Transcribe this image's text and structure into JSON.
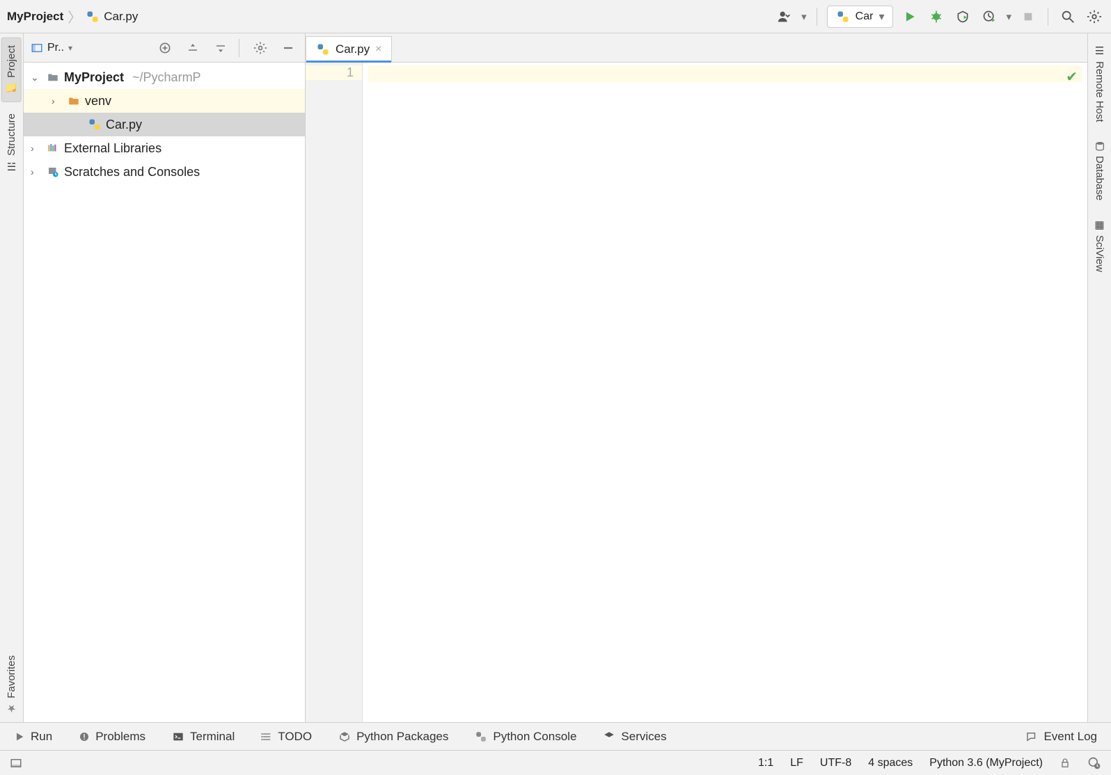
{
  "breadcrumbs": {
    "project": "MyProject",
    "file": "Car.py"
  },
  "runConfig": {
    "name": "Car"
  },
  "leftRail": {
    "project": "Project",
    "structure": "Structure",
    "favorites": "Favorites"
  },
  "rightRail": {
    "remoteHost": "Remote Host",
    "database": "Database",
    "sciview": "SciView"
  },
  "projectPanel": {
    "title": "Pr..",
    "root": {
      "name": "MyProject",
      "path": "~/PycharmP"
    },
    "items": {
      "venv": "venv",
      "carpy": "Car.py",
      "extlib": "External Libraries",
      "scratches": "Scratches and Consoles"
    }
  },
  "editor": {
    "tab": "Car.py",
    "lineNumber": "1"
  },
  "bottomTools": {
    "run": "Run",
    "problems": "Problems",
    "terminal": "Terminal",
    "todo": "TODO",
    "pypackages": "Python Packages",
    "pyconsole": "Python Console",
    "services": "Services",
    "eventlog": "Event Log"
  },
  "statusBar": {
    "pos": "1:1",
    "lineEnding": "LF",
    "encoding": "UTF-8",
    "indent": "4 spaces",
    "interpreter": "Python 3.6 (MyProject)"
  }
}
